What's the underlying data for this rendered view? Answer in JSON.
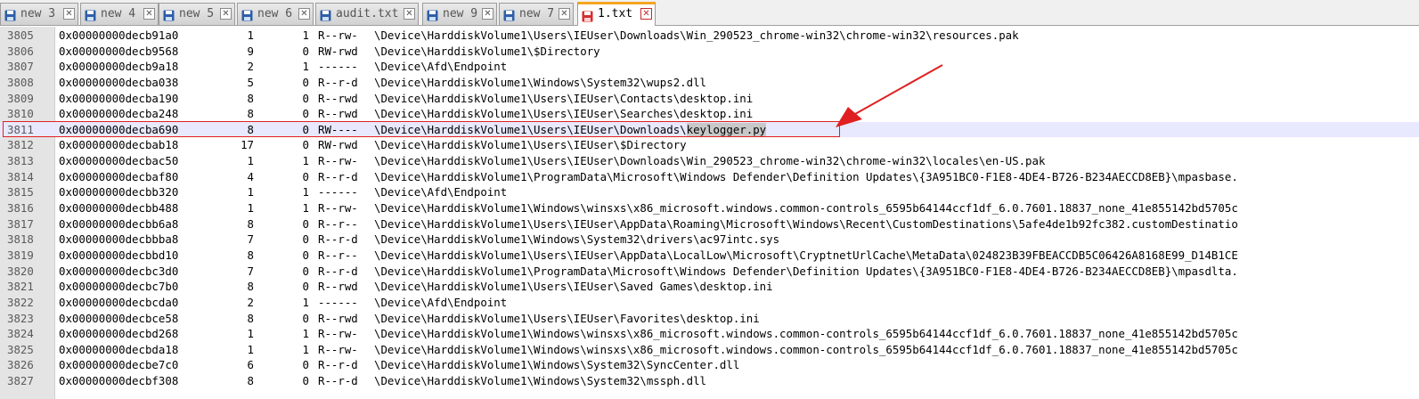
{
  "tabs": [
    {
      "label": "new 3",
      "icon": "floppy-save-icon"
    },
    {
      "label": "new 4",
      "icon": "floppy-save-icon"
    },
    {
      "label": "new 5",
      "icon": "floppy-save-icon"
    },
    {
      "label": "new 6",
      "icon": "floppy-save-icon"
    },
    {
      "label": "audit.txt",
      "icon": "floppy-save-icon"
    },
    {
      "label": "new 9",
      "icon": "floppy-save-icon"
    },
    {
      "label": "new 7",
      "icon": "floppy-save-icon"
    },
    {
      "label": "1.txt",
      "icon": "floppy-unsaved-icon",
      "active": true
    }
  ],
  "colors": {
    "active_tab_accent": "#f5a623",
    "annotation_red": "#e02020",
    "current_line": "#e8e8ff",
    "selection": "#c8c8c8"
  },
  "lines": [
    {
      "num": "3805",
      "addr": "0x00000000decb91a0",
      "n1": "1",
      "n2": "1",
      "perm": "R--rw-",
      "path": "\\Device\\HarddiskVolume1\\Users\\IEUser\\Downloads\\Win_290523_chrome-win32\\chrome-win32\\resources.pak"
    },
    {
      "num": "3806",
      "addr": "0x00000000decb9568",
      "n1": "9",
      "n2": "0",
      "perm": "RW-rwd",
      "path": "\\Device\\HarddiskVolume1\\$Directory"
    },
    {
      "num": "3807",
      "addr": "0x00000000decb9a18",
      "n1": "2",
      "n2": "1",
      "perm": "------",
      "path": "\\Device\\Afd\\Endpoint"
    },
    {
      "num": "3808",
      "addr": "0x00000000decba038",
      "n1": "5",
      "n2": "0",
      "perm": "R--r-d",
      "path": "\\Device\\HarddiskVolume1\\Windows\\System32\\wups2.dll"
    },
    {
      "num": "3809",
      "addr": "0x00000000decba190",
      "n1": "8",
      "n2": "0",
      "perm": "R--rwd",
      "path": "\\Device\\HarddiskVolume1\\Users\\IEUser\\Contacts\\desktop.ini"
    },
    {
      "num": "3810",
      "addr": "0x00000000decba248",
      "n1": "8",
      "n2": "0",
      "perm": "R--rwd",
      "path": "\\Device\\HarddiskVolume1\\Users\\IEUser\\Searches\\desktop.ini"
    },
    {
      "num": "3811",
      "addr": "0x00000000decba690",
      "n1": "8",
      "n2": "0",
      "perm": "RW----",
      "path": "\\Device\\HarddiskVolume1\\Users\\IEUser\\Downloads\\",
      "path_hl": "keylogger.py",
      "current": true
    },
    {
      "num": "3812",
      "addr": "0x00000000decbab18",
      "n1": "17",
      "n2": "0",
      "perm": "RW-rwd",
      "path": "\\Device\\HarddiskVolume1\\Users\\IEUser\\$Directory"
    },
    {
      "num": "3813",
      "addr": "0x00000000decbac50",
      "n1": "1",
      "n2": "1",
      "perm": "R--rw-",
      "path": "\\Device\\HarddiskVolume1\\Users\\IEUser\\Downloads\\Win_290523_chrome-win32\\chrome-win32\\locales\\en-US.pak"
    },
    {
      "num": "3814",
      "addr": "0x00000000decbaf80",
      "n1": "4",
      "n2": "0",
      "perm": "R--r-d",
      "path": "\\Device\\HarddiskVolume1\\ProgramData\\Microsoft\\Windows Defender\\Definition Updates\\{3A951BC0-F1E8-4DE4-B726-B234AECCD8EB}\\mpasbase."
    },
    {
      "num": "3815",
      "addr": "0x00000000decbb320",
      "n1": "1",
      "n2": "1",
      "perm": "------",
      "path": "\\Device\\Afd\\Endpoint"
    },
    {
      "num": "3816",
      "addr": "0x00000000decbb488",
      "n1": "1",
      "n2": "1",
      "perm": "R--rw-",
      "path": "\\Device\\HarddiskVolume1\\Windows\\winsxs\\x86_microsoft.windows.common-controls_6595b64144ccf1df_6.0.7601.18837_none_41e855142bd5705c"
    },
    {
      "num": "3817",
      "addr": "0x00000000decbb6a8",
      "n1": "8",
      "n2": "0",
      "perm": "R--r--",
      "path": "\\Device\\HarddiskVolume1\\Users\\IEUser\\AppData\\Roaming\\Microsoft\\Windows\\Recent\\CustomDestinations\\5afe4de1b92fc382.customDestinatio"
    },
    {
      "num": "3818",
      "addr": "0x00000000decbbba8",
      "n1": "7",
      "n2": "0",
      "perm": "R--r-d",
      "path": "\\Device\\HarddiskVolume1\\Windows\\System32\\drivers\\ac97intc.sys"
    },
    {
      "num": "3819",
      "addr": "0x00000000decbbd10",
      "n1": "8",
      "n2": "0",
      "perm": "R--r--",
      "path": "\\Device\\HarddiskVolume1\\Users\\IEUser\\AppData\\LocalLow\\Microsoft\\CryptnetUrlCache\\MetaData\\024823B39FBEACCDB5C06426A8168E99_D14B1CE"
    },
    {
      "num": "3820",
      "addr": "0x00000000decbc3d0",
      "n1": "7",
      "n2": "0",
      "perm": "R--r-d",
      "path": "\\Device\\HarddiskVolume1\\ProgramData\\Microsoft\\Windows Defender\\Definition Updates\\{3A951BC0-F1E8-4DE4-B726-B234AECCD8EB}\\mpasdlta."
    },
    {
      "num": "3821",
      "addr": "0x00000000decbc7b0",
      "n1": "8",
      "n2": "0",
      "perm": "R--rwd",
      "path": "\\Device\\HarddiskVolume1\\Users\\IEUser\\Saved Games\\desktop.ini"
    },
    {
      "num": "3822",
      "addr": "0x00000000decbcda0",
      "n1": "2",
      "n2": "1",
      "perm": "------",
      "path": "\\Device\\Afd\\Endpoint"
    },
    {
      "num": "3823",
      "addr": "0x00000000decbce58",
      "n1": "8",
      "n2": "0",
      "perm": "R--rwd",
      "path": "\\Device\\HarddiskVolume1\\Users\\IEUser\\Favorites\\desktop.ini"
    },
    {
      "num": "3824",
      "addr": "0x00000000decbd268",
      "n1": "1",
      "n2": "1",
      "perm": "R--rw-",
      "path": "\\Device\\HarddiskVolume1\\Windows\\winsxs\\x86_microsoft.windows.common-controls_6595b64144ccf1df_6.0.7601.18837_none_41e855142bd5705c"
    },
    {
      "num": "3825",
      "addr": "0x00000000decbda18",
      "n1": "1",
      "n2": "1",
      "perm": "R--rw-",
      "path": "\\Device\\HarddiskVolume1\\Windows\\winsxs\\x86_microsoft.windows.common-controls_6595b64144ccf1df_6.0.7601.18837_none_41e855142bd5705c"
    },
    {
      "num": "3826",
      "addr": "0x00000000decbe7c0",
      "n1": "6",
      "n2": "0",
      "perm": "R--r-d",
      "path": "\\Device\\HarddiskVolume1\\Windows\\System32\\SyncCenter.dll"
    },
    {
      "num": "3827",
      "addr": "0x00000000decbf308",
      "n1": "8",
      "n2": "0",
      "perm": "R--r-d",
      "path": "\\Device\\HarddiskVolume1\\Windows\\System32\\mssph.dll"
    }
  ]
}
